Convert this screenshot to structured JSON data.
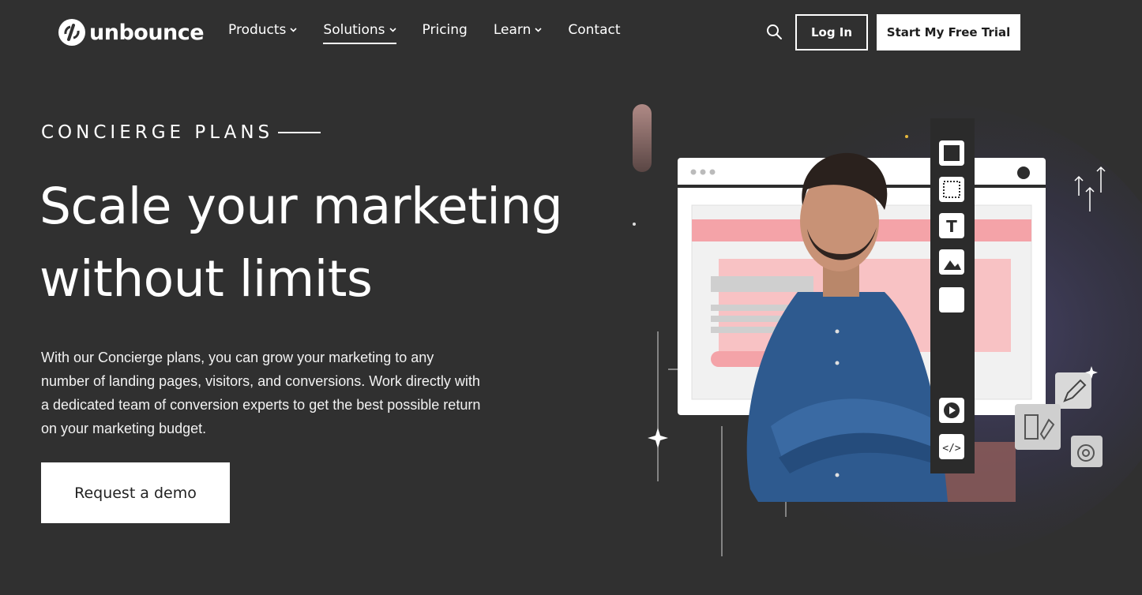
{
  "brand": {
    "name": "unbounce"
  },
  "nav": {
    "links": [
      {
        "label": "Products",
        "has_dropdown": true,
        "active": false
      },
      {
        "label": "Solutions",
        "has_dropdown": true,
        "active": true
      },
      {
        "label": "Pricing",
        "has_dropdown": false,
        "active": false
      },
      {
        "label": "Learn",
        "has_dropdown": true,
        "active": false
      },
      {
        "label": "Contact",
        "has_dropdown": false,
        "active": false
      }
    ],
    "search_icon": "search-icon",
    "login_label": "Log In",
    "trial_label": "Start My Free Trial"
  },
  "hero": {
    "eyebrow": "CONCIERGE PLANS",
    "headline_line1": "Scale your marketing",
    "headline_line2": "without limits",
    "body": "With our Concierge plans, you can grow your marketing to any number of landing pages, visitors, and conversions. Work directly with a dedicated team of conversion experts to get the best possible return on your marketing budget.",
    "cta_label": "Request a demo"
  },
  "illustration": {
    "toolbar_icons": [
      "section-icon",
      "box-icon",
      "text-icon",
      "image-icon",
      "button-icon",
      "form-icon",
      "social-icon",
      "divider-icon",
      "video-icon",
      "code-icon"
    ],
    "floating_icons": [
      "pencil-icon",
      "layout-edit-icon",
      "target-icon",
      "up-arrows-icon"
    ],
    "colors": {
      "accent_pink": "#f4a3a8",
      "panel_bg": "#ffffff",
      "glow": "#3d3a5c"
    }
  }
}
